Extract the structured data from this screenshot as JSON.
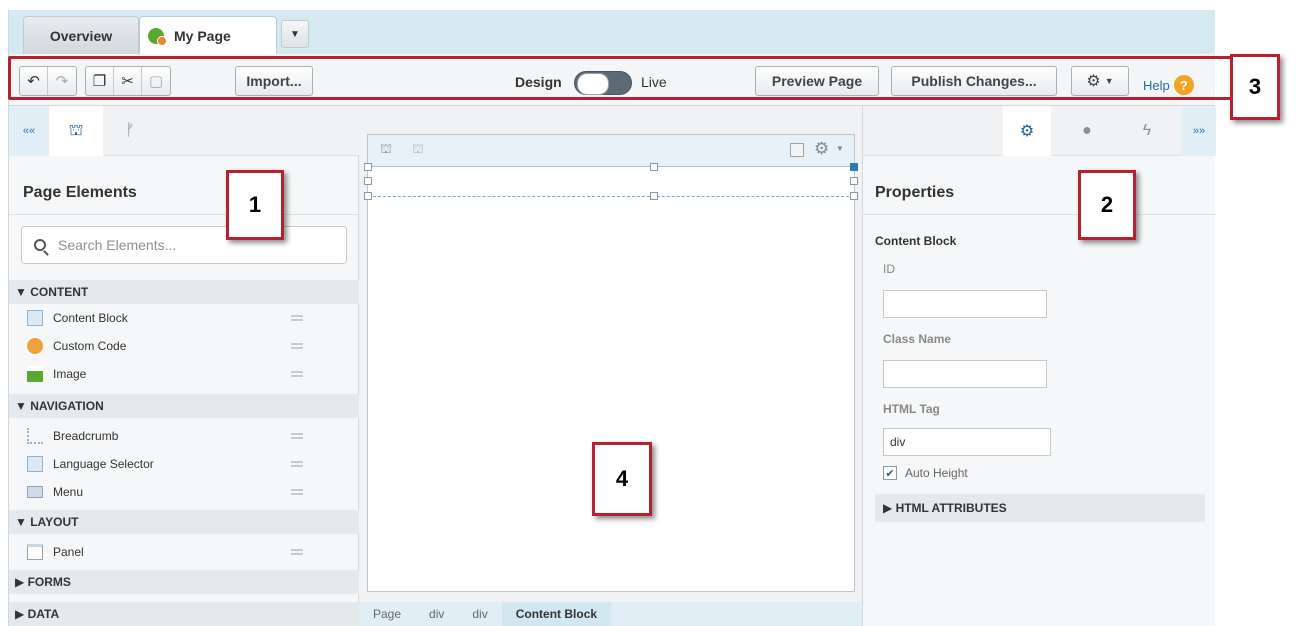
{
  "tabs": [
    {
      "label": "Overview"
    },
    {
      "label": "My Page"
    }
  ],
  "toolbar": {
    "import_label": "Import...",
    "design_label": "Design",
    "live_label": "Live",
    "preview_label": "Preview Page",
    "publish_label": "Publish Changes...",
    "help_label": "Help"
  },
  "left_panel": {
    "title": "Page Elements",
    "search_placeholder": "Search Elements...",
    "sections": [
      {
        "label": "▼ CONTENT",
        "items": [
          "Content Block",
          "Custom Code",
          "Image"
        ]
      },
      {
        "label": "▼ NAVIGATION",
        "items": [
          "Breadcrumb",
          "Language Selector",
          "Menu"
        ]
      },
      {
        "label": "▼ LAYOUT",
        "items": [
          "Panel"
        ]
      },
      {
        "label": "▶ FORMS",
        "items": []
      },
      {
        "label": "▶ DATA",
        "items": []
      }
    ]
  },
  "canvas": {
    "breadcrumb": [
      "Page",
      "div",
      "div",
      "Content Block"
    ]
  },
  "right_panel": {
    "title": "Properties",
    "component": "Content Block",
    "id_label": "ID",
    "class_label": "Class Name",
    "html_tag_label": "HTML Tag",
    "html_tag_value": "div",
    "auto_height_label": "Auto Height",
    "auto_height_checked": true,
    "attributes_label": "▶ HTML ATTRIBUTES"
  },
  "callouts": [
    "1",
    "2",
    "3",
    "4"
  ],
  "colors": {
    "tab_bar": "#d5e9f1",
    "callout_border": "#b7202f",
    "link": "#1f6db0",
    "help_icon": "#f4a423"
  },
  "icons": {
    "undo": "undo-icon",
    "redo": "redo-icon",
    "copy": "copy-icon",
    "cut": "scissors-icon",
    "paste": "paste-icon",
    "settings": "gear-icon",
    "elements": "hierarchy-icon",
    "branch": "branch-icon",
    "style": "drop-icon",
    "events": "lightning-icon"
  }
}
